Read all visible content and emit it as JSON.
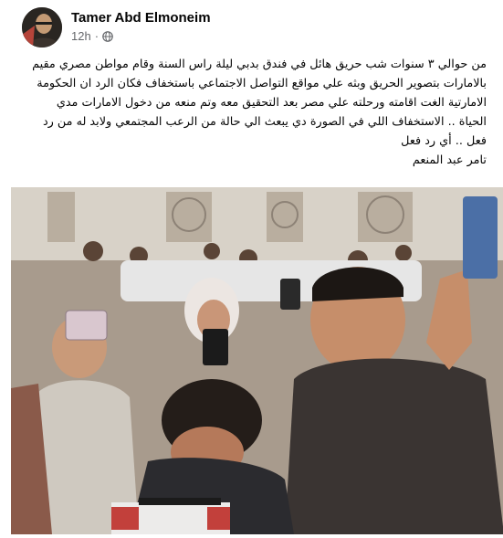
{
  "post": {
    "author": "Tamer Abd Elmoneim",
    "time": "12h",
    "separator": "·",
    "privacy_icon": "globe-icon",
    "text_lines": [
      "من حوالي ٣ سنوات شب حريق هائل في فندق بدبي ليلة راس السنة وقام مواطن مصري مقيم",
      "بالامارات بتصوير الحريق وبثه علي مواقع التواصل الاجتماعي باستخفاف  فكان الرد ان الحكومة",
      "الامارتية الغت اقامته ورحلته علي مصر بعد التحقيق معه وتم منعه من دخول الامارات مدي",
      "الحياة .. الاستخفاف اللي في الصورة دي يبعث الي حالة من الرعب المجتمعي ولابد له من رد",
      "فعل .. أي رد فعل",
      "تامر عبد المنعم"
    ],
    "photo_alt": "crowd-photo"
  },
  "colors": {
    "text_primary": "#050505",
    "text_secondary": "#65676b",
    "background": "#ffffff"
  }
}
